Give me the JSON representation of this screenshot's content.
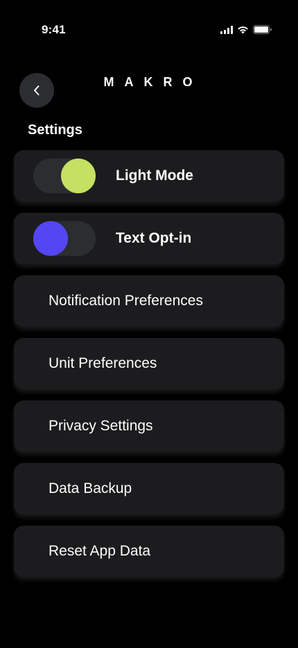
{
  "status_bar": {
    "time": "9:41",
    "icons": [
      "cellular-signal-icon",
      "wifi-icon",
      "battery-icon"
    ]
  },
  "header": {
    "back_icon": "chevron-left-icon",
    "brand": "MAKRO"
  },
  "section_title": "Settings",
  "toggles": [
    {
      "label": "Light Mode",
      "state": "on",
      "knob_color": "#c5e063"
    },
    {
      "label": "Text Opt-in",
      "state": "off",
      "knob_color": "#5446f2"
    }
  ],
  "menu_items": [
    {
      "label": "Notification Preferences"
    },
    {
      "label": "Unit Preferences"
    },
    {
      "label": "Privacy Settings"
    },
    {
      "label": "Data Backup"
    },
    {
      "label": "Reset App Data"
    }
  ],
  "colors": {
    "background": "#000000",
    "card": "#1c1c1e",
    "toggle_track": "#2b2d31",
    "accent_green": "#c5e063",
    "accent_purple": "#5446f2"
  }
}
